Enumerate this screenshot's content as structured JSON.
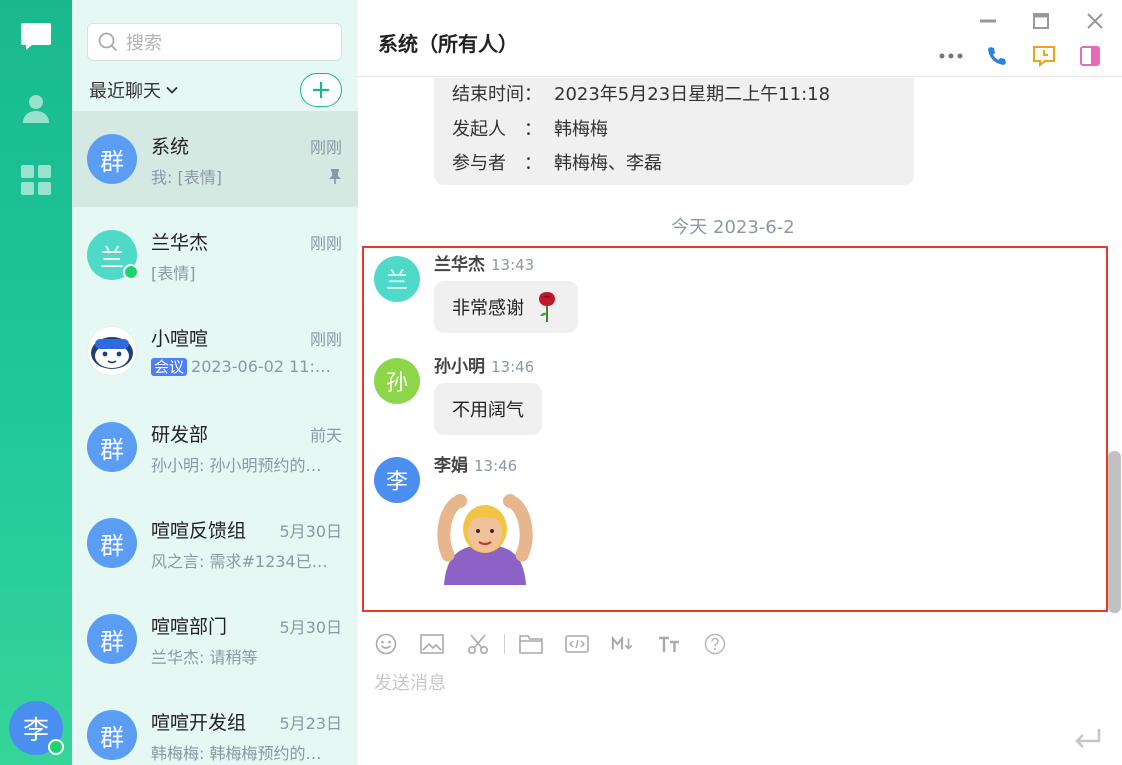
{
  "user": {
    "avatar_text": "李"
  },
  "search": {
    "placeholder": "搜索"
  },
  "list_header": {
    "label": "最近聊天"
  },
  "conversations": [
    {
      "avatar_text": "群",
      "name": "系统",
      "time": "刚刚",
      "preview": "我: [表情]",
      "avatar_color": "#5a9df2",
      "pinned": true
    },
    {
      "avatar_text": "兰",
      "name": "兰华杰",
      "time": "刚刚",
      "preview": "[表情]",
      "avatar_color": "#4fd9c9",
      "online": true
    },
    {
      "avatar_text": "",
      "name": "小喧喧",
      "time": "刚刚",
      "tag": "会议",
      "preview": "2023-06-02 11:…",
      "avatar_color": "#ffffff"
    },
    {
      "avatar_text": "群",
      "name": "研发部",
      "time": "前天",
      "preview": "孙小明: 孙小明预约的…",
      "avatar_color": "#5a9df2"
    },
    {
      "avatar_text": "群",
      "name": "喧喧反馈组",
      "time": "5月30日",
      "preview": "风之言: 需求#1234已…",
      "avatar_color": "#5a9df2"
    },
    {
      "avatar_text": "群",
      "name": "喧喧部门",
      "time": "5月30日",
      "preview": "兰华杰: 请稍等",
      "avatar_color": "#5a9df2"
    },
    {
      "avatar_text": "群",
      "name": "喧喧开发组",
      "time": "5月23日",
      "preview": "韩梅梅: 韩梅梅预约的…",
      "avatar_color": "#5a9df2"
    }
  ],
  "chat": {
    "title": "系统（所有人）",
    "system_card": [
      {
        "label": "结束时间：",
        "value": "2023年5月23日星期二上午11:18"
      },
      {
        "label": "发起人　：",
        "value": "韩梅梅"
      },
      {
        "label": "参与者　：",
        "value": "韩梅梅、李磊"
      }
    ],
    "date_separator": "今天 2023-6-2",
    "messages": [
      {
        "avatar_text": "兰",
        "sender": "兰华杰",
        "time": "13:43",
        "text": "非常感谢",
        "emoji": "rose-emoji",
        "avatar_color": "#4fd9c9"
      },
      {
        "avatar_text": "孙",
        "sender": "孙小明",
        "time": "13:46",
        "text": "不用阔气",
        "avatar_color": "#8dd64a"
      },
      {
        "avatar_text": "李",
        "sender": "李娟",
        "time": "13:46",
        "sticker": "woman-gesturing-ok-sticker",
        "avatar_color": "#4a8ff0"
      }
    ],
    "composer_placeholder": "发送消息"
  },
  "colors": {
    "accent": "#18b88e",
    "highlight_border": "#e63a2e",
    "online": "#1bd46c"
  }
}
